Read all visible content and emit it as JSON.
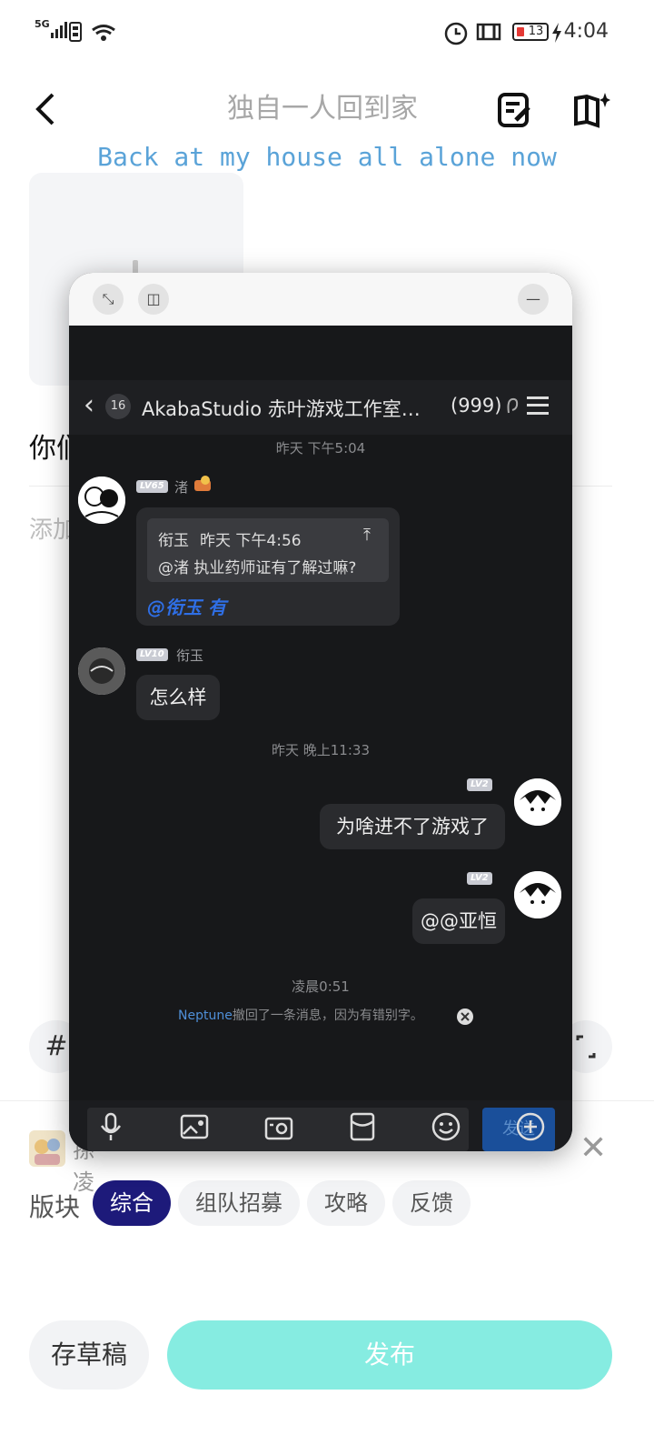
{
  "status_bar": {
    "network": "5G",
    "time": "4:04",
    "battery": "13"
  },
  "header": {
    "title": "独自一人回到家",
    "lyric": "Back at my house all alone now"
  },
  "editor": {
    "title_fragment": "你们",
    "body_fragment": "添加",
    "topic_chip": "#"
  },
  "game": {
    "name_fragment": "孫凌"
  },
  "board": {
    "label": "版块",
    "chips": [
      "综合",
      "组队招募",
      "攻略",
      "反馈"
    ]
  },
  "actions": {
    "draft": "存草稿",
    "publish": "发布"
  },
  "float_window": {
    "chat": {
      "unread_badge": "16",
      "group_name": "AkabaStudio 赤叶游戏工作室…",
      "member_count": "(999)",
      "timestamps": [
        "昨天 下午5:04",
        "昨天 晚上11:33",
        "凌晨0:51"
      ],
      "messages": [
        {
          "level": "LV65",
          "nick": "渚",
          "quote_author": "衔玉",
          "quote_time": "昨天 下午4:56",
          "quote_text": "@渚 执业药师证有了解过嘛?",
          "text": "@衔玉 有"
        },
        {
          "level": "LV10",
          "nick": "衔玉",
          "text": "怎么样"
        },
        {
          "level": "LV2",
          "text": "为啥进不了游戏了"
        },
        {
          "level": "LV2",
          "text": "@@亚恒"
        }
      ],
      "recall_notice": {
        "name": "Neptune",
        "text": "撤回了一条消息，因为有错别字。"
      },
      "send_button": "发送"
    }
  },
  "colors": {
    "accent": "#1d1a7a",
    "publish": "#86ece1",
    "lyric": "#5aa3d8",
    "mention": "#2f6fe6"
  }
}
